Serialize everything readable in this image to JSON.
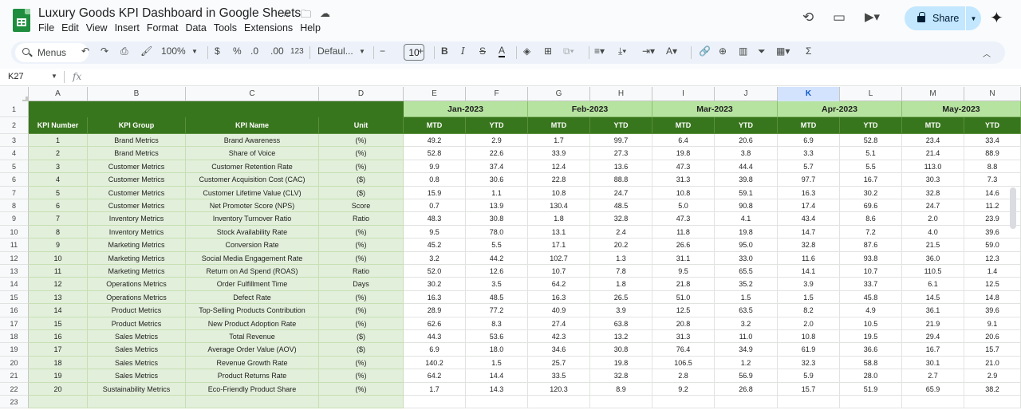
{
  "doc": {
    "title": "Luxury Goods KPI Dashboard in Google Sheets"
  },
  "menu": [
    "File",
    "Edit",
    "View",
    "Insert",
    "Format",
    "Data",
    "Tools",
    "Extensions",
    "Help"
  ],
  "share": {
    "label": "Share"
  },
  "toolbar": {
    "search_label": "Menus",
    "zoom": "100%",
    "currency": "$",
    "percent": "%",
    "dec_decrease": ".0",
    "dec_increase": ".00",
    "format_123": "123",
    "font": "Defaul...",
    "font_size": "10"
  },
  "formula_bar": {
    "cell_ref": "K27"
  },
  "columns": [
    "A",
    "B",
    "C",
    "D",
    "E",
    "F",
    "G",
    "H",
    "I",
    "J",
    "K",
    "L",
    "M",
    "N"
  ],
  "selected_column": "K",
  "row_numbers": [
    "1",
    "2",
    "3",
    "4",
    "5",
    "6",
    "7",
    "8",
    "9",
    "10",
    "11",
    "12",
    "13",
    "14",
    "15",
    "16",
    "17",
    "18",
    "19",
    "20",
    "21",
    "22",
    "23"
  ],
  "months": [
    "Jan-2023",
    "Feb-2023",
    "Mar-2023",
    "Apr-2023",
    "May-2023"
  ],
  "headers": {
    "kpi_number": "KPI Number",
    "kpi_group": "KPI Group",
    "kpi_name": "KPI Name",
    "unit": "Unit",
    "mtd": "MTD",
    "ytd": "YTD"
  },
  "rows": [
    {
      "num": "1",
      "group": "Brand Metrics",
      "name": "Brand Awareness",
      "unit": "(%)",
      "vals": [
        "49.2",
        "2.9",
        "1.7",
        "99.7",
        "6.4",
        "20.6",
        "6.9",
        "52.8",
        "23.4",
        "33.4"
      ]
    },
    {
      "num": "2",
      "group": "Brand Metrics",
      "name": "Share of Voice",
      "unit": "(%)",
      "vals": [
        "52.8",
        "22.6",
        "33.9",
        "27.3",
        "19.8",
        "3.8",
        "3.3",
        "5.1",
        "21.4",
        "88.9"
      ]
    },
    {
      "num": "3",
      "group": "Customer Metrics",
      "name": "Customer Retention Rate",
      "unit": "(%)",
      "vals": [
        "9.9",
        "37.4",
        "12.4",
        "13.6",
        "47.3",
        "44.4",
        "5.7",
        "5.5",
        "113.0",
        "8.8"
      ]
    },
    {
      "num": "4",
      "group": "Customer Metrics",
      "name": "Customer Acquisition Cost (CAC)",
      "unit": "($)",
      "vals": [
        "0.8",
        "30.6",
        "22.8",
        "88.8",
        "31.3",
        "39.8",
        "97.7",
        "16.7",
        "30.3",
        "7.3"
      ]
    },
    {
      "num": "5",
      "group": "Customer Metrics",
      "name": "Customer Lifetime Value (CLV)",
      "unit": "($)",
      "vals": [
        "15.9",
        "1.1",
        "10.8",
        "24.7",
        "10.8",
        "59.1",
        "16.3",
        "30.2",
        "32.8",
        "14.6"
      ]
    },
    {
      "num": "6",
      "group": "Customer Metrics",
      "name": "Net Promoter Score (NPS)",
      "unit": "Score",
      "vals": [
        "0.7",
        "13.9",
        "130.4",
        "48.5",
        "5.0",
        "90.8",
        "17.4",
        "69.6",
        "24.7",
        "11.2"
      ]
    },
    {
      "num": "7",
      "group": "Inventory Metrics",
      "name": "Inventory Turnover Ratio",
      "unit": "Ratio",
      "vals": [
        "48.3",
        "30.8",
        "1.8",
        "32.8",
        "47.3",
        "4.1",
        "43.4",
        "8.6",
        "2.0",
        "23.9"
      ]
    },
    {
      "num": "8",
      "group": "Inventory Metrics",
      "name": "Stock Availability Rate",
      "unit": "(%)",
      "vals": [
        "9.5",
        "78.0",
        "13.1",
        "2.4",
        "11.8",
        "19.8",
        "14.7",
        "7.2",
        "4.0",
        "39.6"
      ]
    },
    {
      "num": "9",
      "group": "Marketing Metrics",
      "name": "Conversion Rate",
      "unit": "(%)",
      "vals": [
        "45.2",
        "5.5",
        "17.1",
        "20.2",
        "26.6",
        "95.0",
        "32.8",
        "87.6",
        "21.5",
        "59.0"
      ]
    },
    {
      "num": "10",
      "group": "Marketing Metrics",
      "name": "Social Media Engagement Rate",
      "unit": "(%)",
      "vals": [
        "3.2",
        "44.2",
        "102.7",
        "1.3",
        "31.1",
        "33.0",
        "11.6",
        "93.8",
        "36.0",
        "12.3"
      ]
    },
    {
      "num": "11",
      "group": "Marketing Metrics",
      "name": "Return on Ad Spend (ROAS)",
      "unit": "Ratio",
      "vals": [
        "52.0",
        "12.6",
        "10.7",
        "7.8",
        "9.5",
        "65.5",
        "14.1",
        "10.7",
        "110.5",
        "1.4"
      ]
    },
    {
      "num": "12",
      "group": "Operations Metrics",
      "name": "Order Fulfillment Time",
      "unit": "Days",
      "vals": [
        "30.2",
        "3.5",
        "64.2",
        "1.8",
        "21.8",
        "35.2",
        "3.9",
        "33.7",
        "6.1",
        "12.5"
      ]
    },
    {
      "num": "13",
      "group": "Operations Metrics",
      "name": "Defect Rate",
      "unit": "(%)",
      "vals": [
        "16.3",
        "48.5",
        "16.3",
        "26.5",
        "51.0",
        "1.5",
        "1.5",
        "45.8",
        "14.5",
        "14.8"
      ]
    },
    {
      "num": "14",
      "group": "Product Metrics",
      "name": "Top-Selling Products Contribution",
      "unit": "(%)",
      "vals": [
        "28.9",
        "77.2",
        "40.9",
        "3.9",
        "12.5",
        "63.5",
        "8.2",
        "4.9",
        "36.1",
        "39.6"
      ]
    },
    {
      "num": "15",
      "group": "Product Metrics",
      "name": "New Product Adoption Rate",
      "unit": "(%)",
      "vals": [
        "62.6",
        "8.3",
        "27.4",
        "63.8",
        "20.8",
        "3.2",
        "2.0",
        "10.5",
        "21.9",
        "9.1"
      ]
    },
    {
      "num": "16",
      "group": "Sales Metrics",
      "name": "Total Revenue",
      "unit": "($)",
      "vals": [
        "44.3",
        "53.6",
        "42.3",
        "13.2",
        "31.3",
        "11.0",
        "10.8",
        "19.5",
        "29.4",
        "20.6"
      ]
    },
    {
      "num": "17",
      "group": "Sales Metrics",
      "name": "Average Order Value (AOV)",
      "unit": "($)",
      "vals": [
        "6.9",
        "18.0",
        "34.6",
        "30.8",
        "76.4",
        "34.9",
        "61.9",
        "36.6",
        "16.7",
        "15.7"
      ]
    },
    {
      "num": "18",
      "group": "Sales Metrics",
      "name": "Revenue Growth Rate",
      "unit": "(%)",
      "vals": [
        "140.2",
        "1.5",
        "25.7",
        "19.8",
        "106.5",
        "1.2",
        "32.3",
        "58.8",
        "30.1",
        "21.0"
      ]
    },
    {
      "num": "19",
      "group": "Sales Metrics",
      "name": "Product Returns Rate",
      "unit": "(%)",
      "vals": [
        "64.2",
        "14.4",
        "33.5",
        "32.8",
        "2.8",
        "56.9",
        "5.9",
        "28.0",
        "2.7",
        "2.9"
      ]
    },
    {
      "num": "20",
      "group": "Sustainability Metrics",
      "name": "Eco-Friendly Product Share",
      "unit": "(%)",
      "vals": [
        "1.7",
        "14.3",
        "120.3",
        "8.9",
        "9.2",
        "26.8",
        "15.7",
        "51.9",
        "65.9",
        "38.2"
      ]
    }
  ],
  "colors": {
    "header_green": "#38761d",
    "month_green": "#b6e3a0",
    "left_block_green": "#e2efda",
    "share_blue": "#c2e7ff"
  }
}
